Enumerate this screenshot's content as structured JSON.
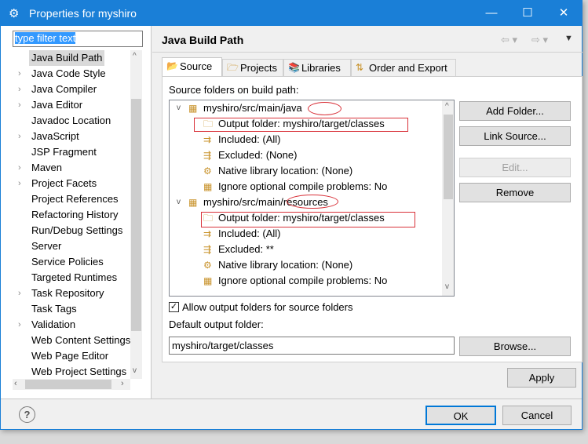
{
  "window": {
    "title": "Properties for myshiro",
    "minimize": "—",
    "maximize": "☐",
    "close": "✕"
  },
  "sidebar": {
    "filter_text": "type filter text",
    "items": [
      {
        "label": "Java Build Path",
        "expandable": false,
        "selected": true
      },
      {
        "label": "Java Code Style",
        "expandable": true
      },
      {
        "label": "Java Compiler",
        "expandable": true
      },
      {
        "label": "Java Editor",
        "expandable": true
      },
      {
        "label": "Javadoc Location",
        "expandable": false
      },
      {
        "label": "JavaScript",
        "expandable": true
      },
      {
        "label": "JSP Fragment",
        "expandable": false
      },
      {
        "label": "Maven",
        "expandable": true
      },
      {
        "label": "Project Facets",
        "expandable": true
      },
      {
        "label": "Project References",
        "expandable": false
      },
      {
        "label": "Refactoring History",
        "expandable": false
      },
      {
        "label": "Run/Debug Settings",
        "expandable": false
      },
      {
        "label": "Server",
        "expandable": false
      },
      {
        "label": "Service Policies",
        "expandable": false
      },
      {
        "label": "Targeted Runtimes",
        "expandable": false
      },
      {
        "label": "Task Repository",
        "expandable": true
      },
      {
        "label": "Task Tags",
        "expandable": false
      },
      {
        "label": "Validation",
        "expandable": true
      },
      {
        "label": "Web Content Settings",
        "expandable": false
      },
      {
        "label": "Web Page Editor",
        "expandable": false
      },
      {
        "label": "Web Project Settings",
        "expandable": false
      }
    ]
  },
  "main": {
    "title": "Java Build Path",
    "tabs": [
      {
        "label": "Source",
        "icon": "source-folder-icon",
        "active": true
      },
      {
        "label": "Projects",
        "icon": "folder-open-icon"
      },
      {
        "label": "Libraries",
        "icon": "library-icon"
      },
      {
        "label": "Order and Export",
        "icon": "order-icon"
      }
    ],
    "source_label": "Source folders on build path:",
    "tree": [
      {
        "level": 0,
        "text": "myshiro/src/main/java",
        "icon": "package-folder-icon"
      },
      {
        "level": 1,
        "text": "Output folder: myshiro/target/classes",
        "icon": "output-folder-icon",
        "highlight": true
      },
      {
        "level": 1,
        "text": "Included: (All)",
        "icon": "include-filter-icon"
      },
      {
        "level": 1,
        "text": "Excluded: (None)",
        "icon": "exclude-filter-icon"
      },
      {
        "level": 1,
        "text": "Native library location: (None)",
        "icon": "native-library-icon"
      },
      {
        "level": 1,
        "text": "Ignore optional compile problems: No",
        "icon": "ignore-problems-icon"
      },
      {
        "level": 0,
        "text": "myshiro/src/main/resources",
        "icon": "package-folder-icon"
      },
      {
        "level": 1,
        "text": "Output folder: myshiro/target/classes",
        "icon": "output-folder-icon",
        "highlight": true
      },
      {
        "level": 1,
        "text": "Included: (All)",
        "icon": "include-filter-icon"
      },
      {
        "level": 1,
        "text": "Excluded: **",
        "icon": "exclude-filter-icon"
      },
      {
        "level": 1,
        "text": "Native library location: (None)",
        "icon": "native-library-icon"
      },
      {
        "level": 1,
        "text": "Ignore optional compile problems: No",
        "icon": "ignore-problems-icon"
      }
    ],
    "buttons": {
      "add_folder": "Add Folder...",
      "link_source": "Link Source...",
      "edit": "Edit...",
      "remove": "Remove",
      "browse": "Browse..."
    },
    "allow_output_label": "Allow output folders for source folders",
    "allow_output_checked": true,
    "default_output_label": "Default output folder:",
    "default_output_value": "myshiro/target/classes"
  },
  "footer": {
    "apply": "Apply",
    "ok": "OK",
    "cancel": "Cancel"
  },
  "colors": {
    "titlebar": "#1a7fd7",
    "annotation": "#d9323a"
  }
}
